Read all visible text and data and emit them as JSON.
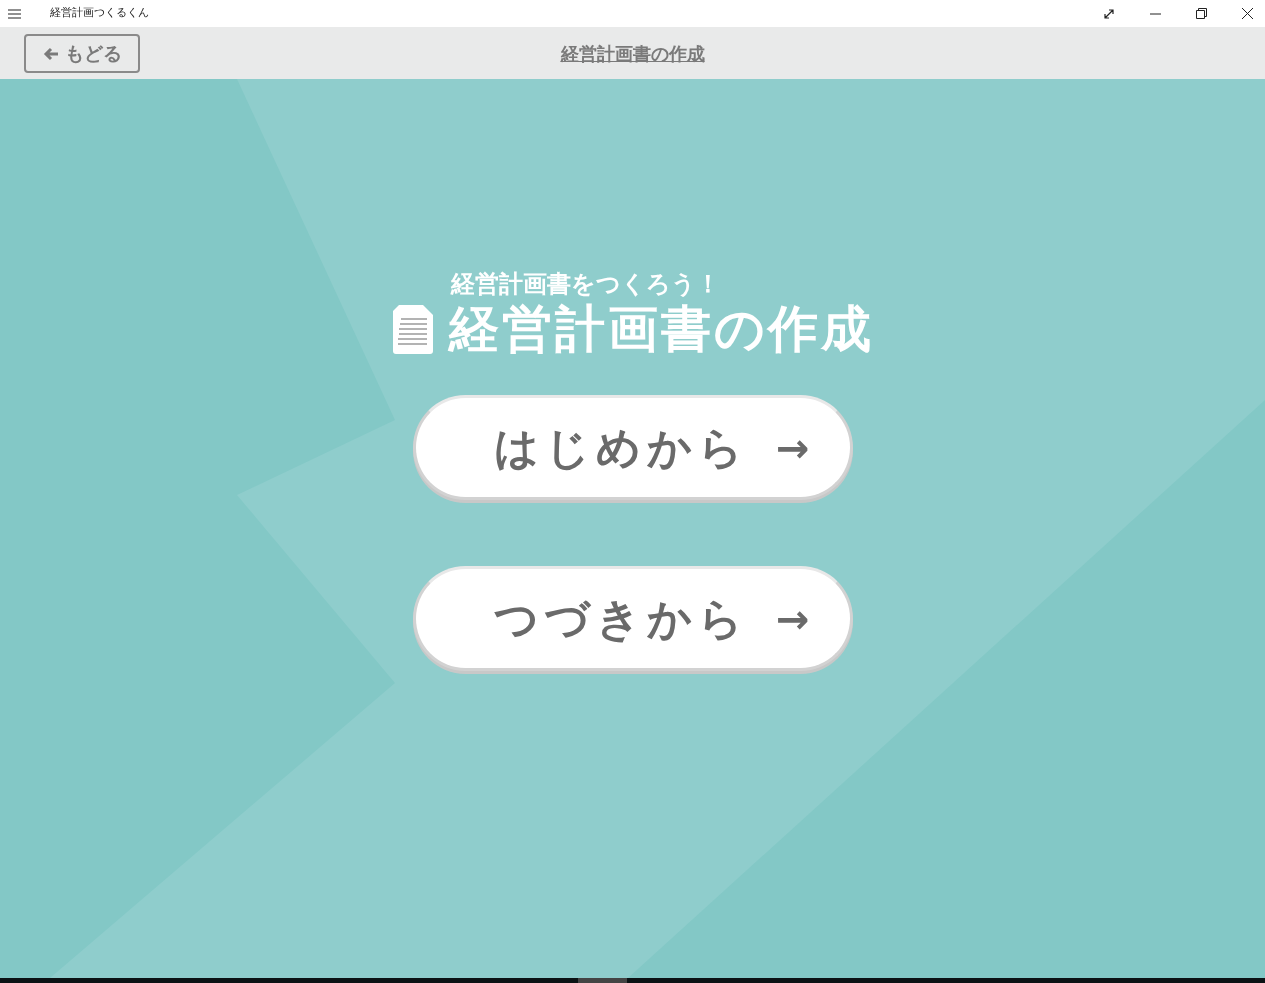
{
  "window": {
    "title": "経営計画つくるくん"
  },
  "header": {
    "back_button": "もどる",
    "title": "経営計画書の作成"
  },
  "main": {
    "subtitle": "経営計画書をつくろう！",
    "title": "経営計画書の作成",
    "buttons": [
      {
        "label": "はじめから",
        "arrow": "→"
      },
      {
        "label": "つづきから",
        "arrow": "→"
      }
    ]
  }
}
